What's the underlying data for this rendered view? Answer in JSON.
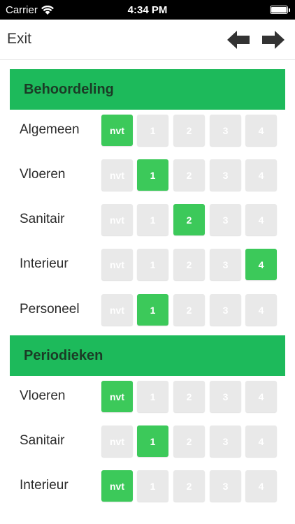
{
  "status_bar": {
    "carrier": "Carrier",
    "time": "4:34 PM"
  },
  "nav": {
    "exit_label": "Exit",
    "back_icon": "arrow-left-icon",
    "forward_icon": "arrow-right-icon"
  },
  "colors": {
    "header_green": "#1dba5b",
    "selected_green": "#3cc95a",
    "unselected_gray": "#e9e9e9"
  },
  "options": [
    "nvt",
    "1",
    "2",
    "3",
    "4"
  ],
  "sections": [
    {
      "title": "Behoordeling",
      "rows": [
        {
          "label": "Algemeen",
          "selected": "nvt"
        },
        {
          "label": "Vloeren",
          "selected": "1"
        },
        {
          "label": "Sanitair",
          "selected": "2"
        },
        {
          "label": "Interieur",
          "selected": "4"
        },
        {
          "label": "Personeel",
          "selected": "1"
        }
      ]
    },
    {
      "title": "Periodieken",
      "rows": [
        {
          "label": "Vloeren",
          "selected": "nvt"
        },
        {
          "label": "Sanitair",
          "selected": "1"
        },
        {
          "label": "Interieur",
          "selected": "nvt"
        }
      ]
    }
  ]
}
